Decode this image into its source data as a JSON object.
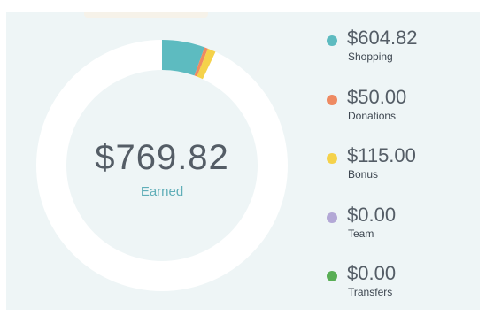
{
  "summary": {
    "total_amount": "$769.82",
    "total_label": "Earned"
  },
  "breakdown": [
    {
      "amount": "$604.82",
      "label": "Shopping",
      "value": 604.82,
      "color": "#5dbbc0"
    },
    {
      "amount": "$50.00",
      "label": "Donations",
      "value": 50.0,
      "color": "#ee8a62"
    },
    {
      "amount": "$115.00",
      "label": "Bonus",
      "value": 115.0,
      "color": "#f5d24a"
    },
    {
      "amount": "$0.00",
      "label": "Team",
      "value": 0.0,
      "color": "#b3a8d6"
    },
    {
      "amount": "$0.00",
      "label": "Transfers",
      "value": 0.0,
      "color": "#59ae55"
    }
  ],
  "ring": {
    "filled_fraction": 0.07,
    "track_color": "#ffffff"
  }
}
